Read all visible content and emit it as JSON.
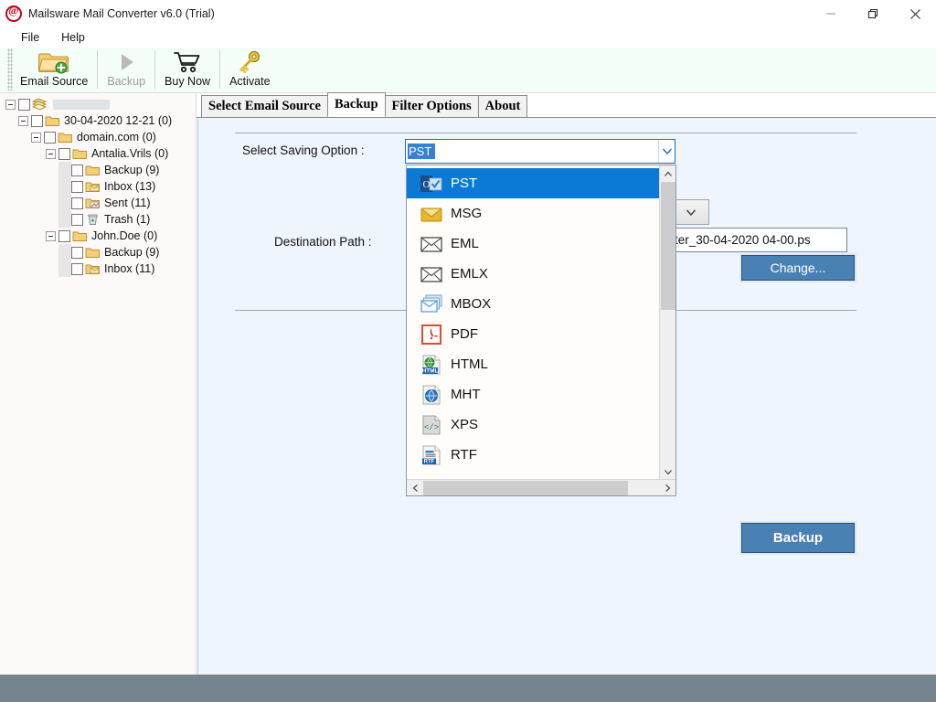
{
  "window": {
    "title": "Mailsware Mail Converter v6.0 (Trial)",
    "app_icon": "at-sign-icon",
    "minimize_label": "—",
    "maximize_label": "❐",
    "close_label": "✕"
  },
  "menubar": {
    "items": [
      {
        "label": "File"
      },
      {
        "label": "Help"
      }
    ]
  },
  "toolbar": {
    "buttons": [
      {
        "label": "Email Source",
        "icon": "folder-add-icon",
        "enabled": true
      },
      {
        "label": "Backup",
        "icon": "play-triangle-icon",
        "enabled": false
      },
      {
        "label": "Buy Now",
        "icon": "shopping-cart-icon",
        "enabled": true
      },
      {
        "label": "Activate",
        "icon": "key-icon",
        "enabled": true
      }
    ]
  },
  "sidebar": {
    "tree": [
      {
        "label": "",
        "redacted": true,
        "depth": 0,
        "expander": "minus",
        "icon": "mail-stack-icon",
        "checkbox": true
      },
      {
        "label": "30-04-2020 12-21 (0)",
        "depth": 1,
        "expander": "minus",
        "icon": "folder-icon",
        "checkbox": true
      },
      {
        "label": "domain.com (0)",
        "depth": 2,
        "expander": "minus",
        "icon": "folder-icon",
        "checkbox": true
      },
      {
        "label": "Antalia.Vrils (0)",
        "depth": 3,
        "expander": "minus",
        "icon": "folder-icon",
        "checkbox": true
      },
      {
        "label": "Backup (9)",
        "depth": 4,
        "expander": "none",
        "icon": "folder-icon",
        "checkbox": true
      },
      {
        "label": "Inbox (13)",
        "depth": 4,
        "expander": "none",
        "icon": "folder-mail-icon",
        "checkbox": true
      },
      {
        "label": "Sent (11)",
        "depth": 4,
        "expander": "none",
        "icon": "folder-sent-icon",
        "checkbox": true
      },
      {
        "label": "Trash (1)",
        "depth": 4,
        "expander": "none",
        "icon": "trash-icon",
        "checkbox": true
      },
      {
        "label": "John.Doe (0)",
        "depth": 3,
        "expander": "minus",
        "icon": "folder-icon",
        "checkbox": true
      },
      {
        "label": "Backup (9)",
        "depth": 4,
        "expander": "none",
        "icon": "folder-icon",
        "checkbox": true
      },
      {
        "label": "Inbox (11)",
        "depth": 4,
        "expander": "none",
        "icon": "folder-mail-icon",
        "checkbox": true
      }
    ]
  },
  "tabs": [
    {
      "label": "Select Email Source",
      "active": false
    },
    {
      "label": "Backup",
      "active": true
    },
    {
      "label": "Filter Options",
      "active": false
    },
    {
      "label": "About",
      "active": false
    }
  ],
  "backup_panel": {
    "saving_option_label": "Select Saving Option :",
    "saving_option_value": "PST",
    "destination_path_label": "Destination Path :",
    "destination_path_value": "ter_30-04-2020 04-00.ps",
    "change_button": "Change...",
    "backup_button": "Backup",
    "dropdown_arrow_icon": "chevron-down-icon"
  },
  "saving_option_dropdown": {
    "open": true,
    "selected_index": 0,
    "scroll_up_icon": "chevron-up-icon",
    "scroll_down_icon": "chevron-down-icon",
    "scroll_left_icon": "chevron-left-icon",
    "scroll_right_icon": "chevron-right-icon",
    "options": [
      {
        "label": "PST",
        "icon": "outlook-pst-icon"
      },
      {
        "label": "MSG",
        "icon": "yellow-envelope-icon"
      },
      {
        "label": "EML",
        "icon": "envelope-outline-icon"
      },
      {
        "label": "EMLX",
        "icon": "envelope-outline-icon"
      },
      {
        "label": "MBOX",
        "icon": "envelope-stack-icon"
      },
      {
        "label": "PDF",
        "icon": "pdf-icon"
      },
      {
        "label": "HTML",
        "icon": "html-file-icon"
      },
      {
        "label": "MHT",
        "icon": "mht-globe-icon"
      },
      {
        "label": "XPS",
        "icon": "xps-code-icon"
      },
      {
        "label": "RTF",
        "icon": "rtf-file-icon"
      }
    ]
  },
  "colors": {
    "accent_blue": "#0a7ad6",
    "button_blue": "#4a81b4",
    "panel_bg": "#eff5fd",
    "toolbar_bg": "#f5fffa",
    "sidebar_bg": "#fdf9f9",
    "statusbar": "#76848f",
    "title_red": "#c00418"
  },
  "statusbar": {
    "text": ""
  }
}
